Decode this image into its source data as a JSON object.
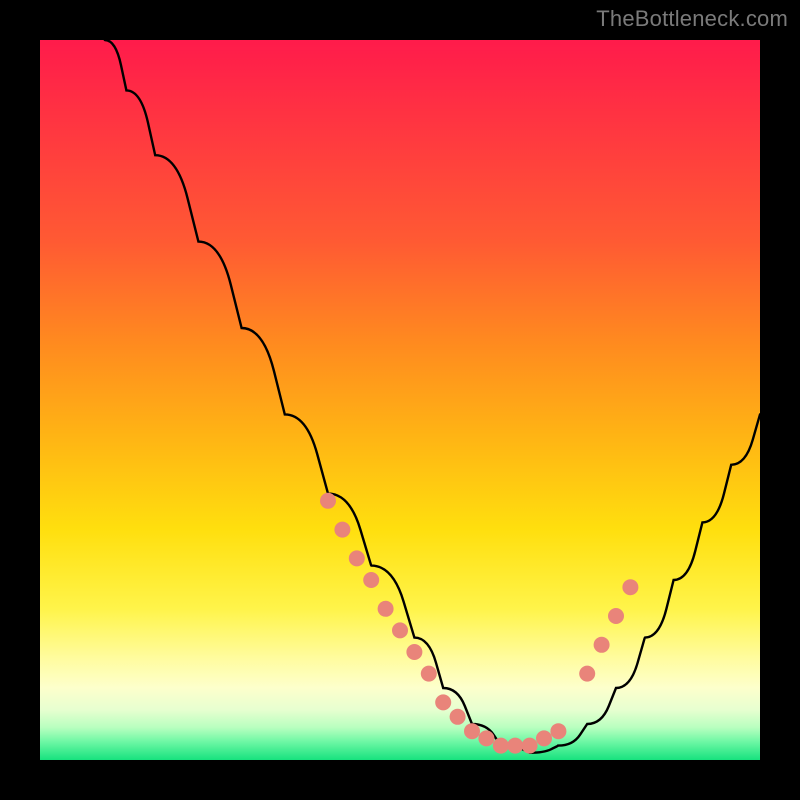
{
  "watermark": "TheBottleneck.com",
  "colors": {
    "page_bg": "#000000",
    "curve": "#000000",
    "dots": "#e9847a",
    "gradient_top": "#ff1b4b",
    "gradient_bottom": "#17e27e"
  },
  "chart_data": {
    "type": "line",
    "title": "",
    "subtitle": "",
    "xlabel": "",
    "ylabel": "",
    "xlim": [
      0,
      100
    ],
    "ylim": [
      0,
      100
    ],
    "grid": false,
    "legend": false,
    "annotations": [],
    "note": "No axes or tick labels are drawn. x/y are normalized 0–100 across the colored plot area; y=0 is the bottom (green) edge, y=100 is the top (red) edge. Values are estimated from pixel positions.",
    "series": [
      {
        "name": "bottleneck-curve",
        "style": "line",
        "x": [
          9,
          12,
          16,
          22,
          28,
          34,
          40,
          46,
          52,
          56,
          60,
          64,
          68,
          72,
          76,
          80,
          84,
          88,
          92,
          96,
          100
        ],
        "y": [
          100,
          93,
          84,
          72,
          60,
          48,
          37,
          27,
          17,
          10,
          5,
          2,
          1,
          2,
          5,
          10,
          17,
          25,
          33,
          41,
          48
        ]
      },
      {
        "name": "highlight-dots-left",
        "style": "scatter",
        "x": [
          40,
          42,
          44,
          46,
          48,
          50,
          52,
          54
        ],
        "y": [
          36,
          32,
          28,
          25,
          21,
          18,
          15,
          12
        ]
      },
      {
        "name": "highlight-dots-valley",
        "style": "scatter",
        "x": [
          56,
          58,
          60,
          62,
          64,
          66,
          68,
          70,
          72
        ],
        "y": [
          8,
          6,
          4,
          3,
          2,
          2,
          2,
          3,
          4
        ]
      },
      {
        "name": "highlight-dots-right",
        "style": "scatter",
        "x": [
          76,
          78,
          80,
          82
        ],
        "y": [
          12,
          16,
          20,
          24
        ]
      }
    ]
  }
}
